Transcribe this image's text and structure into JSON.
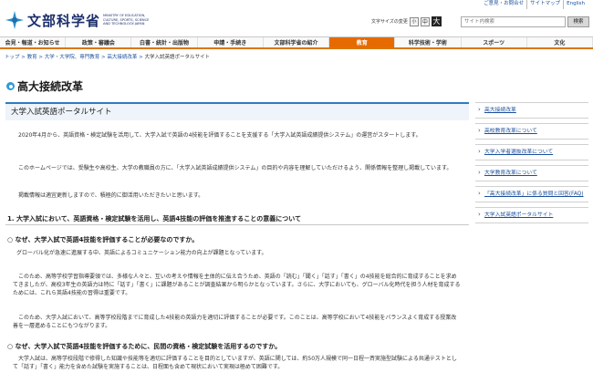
{
  "utility_links": [
    "ご意見・お問合せ",
    "サイトマップ",
    "English"
  ],
  "header": {
    "logo_jp": "文部科学省",
    "logo_en": "MINISTRY OF EDUCATION, CULTURE, SPORTS, SCIENCE AND TECHNOLOGY-JAPAN",
    "font_size_label": "文字サイズの変更",
    "font_sizes": [
      "小",
      "中",
      "大"
    ],
    "search_placeholder": "サイト内検索",
    "search_button": "検索"
  },
  "nav": [
    "会見・報道・お知らせ",
    "政策・審議会",
    "白書・統計・出版物",
    "申請・手続き",
    "文部科学省の紹介",
    "教育",
    "科学技術・学術",
    "スポーツ",
    "文化"
  ],
  "nav_active_index": 5,
  "breadcrumb": {
    "links": [
      "トップ",
      "教育",
      "大学・大学院、専門教育",
      "高大接続改革"
    ],
    "current": "大学入試英語ポータルサイト",
    "separator": " > "
  },
  "page_title": "高大接続改革",
  "main": {
    "section_title": "大学入試英語ポータルサイト",
    "p1": "2020年4月から、英語資格・検定試験を活用して、大学入試で英語の4技能を評価することを支援する「大学入試英語成績提供システム」の運営がスタートします。",
    "p2": "このホームページでは、受験生や高校生、大学の教職員の方に、「大学入試英語成績提供システム」の目的や内容を理解していただけるよう、関係情報を整理し掲載しています。",
    "p3": "掲載情報は適宜更新しますので、積極的に御活用いただきたいと思います。",
    "h2": "1. 大学入試において、英語資格・検定試験を活用し、英語4技能の評価を推進することの意義について",
    "q1": "○ なぜ、大学入試で英語4技能を評価することが必要なのですか。",
    "p4": "グローバル化が急速に進展する中、英語によるコミュニケーション能力の向上が課題となっています。",
    "p5": "このため、高等学校学習指導要領では、多様な人々と、互いの考えや情報を主体的に伝え合うため、英語の「読む」「聞く」「話す」「書く」の4技能を総合的に育成することを求めてきましたが、高校3年生の英語力は特に「話す」「書く」に課題があることが調査結果から明らかとなっています。さらに、大学においても、グローバル化時代を担う人材を育成するためには、これら英語4技能の習得は重要です。",
    "p6": "このため、大学入試において、高等学校段階までに育成した4技能の英語力を適切に評価することが必要です。このことは、高等学校において4技能をバランスよく育成する授業改善を一層進めることにもつながります。",
    "q2": "○ なぜ、大学入試で英語4技能を評価するために、民間の資格・検定試験を活用するのですか。",
    "p7": "大学入試は、高等学校段階で修得した知識や技能等を適切に評価することを目的としていますが、英語に関しては、約50万人規模で同一日程一斉実施型試験による共通テストとして「話す」「書く」能力を含めた試験を実施することは、日程面も含めて現状において実現は極めて困難です。"
  },
  "sidebar": [
    "高大接続改革",
    "高校教育改革について",
    "大学入学者選抜改革について",
    "大学教育改革について",
    "「高大接続改革」に係る質問と回答(FAQ)",
    "大学入試英語ポータルサイト"
  ],
  "colors": {
    "accent_orange": "#e56b00",
    "link_blue": "#1a4f9c",
    "title_blue": "#2e9ad6"
  }
}
